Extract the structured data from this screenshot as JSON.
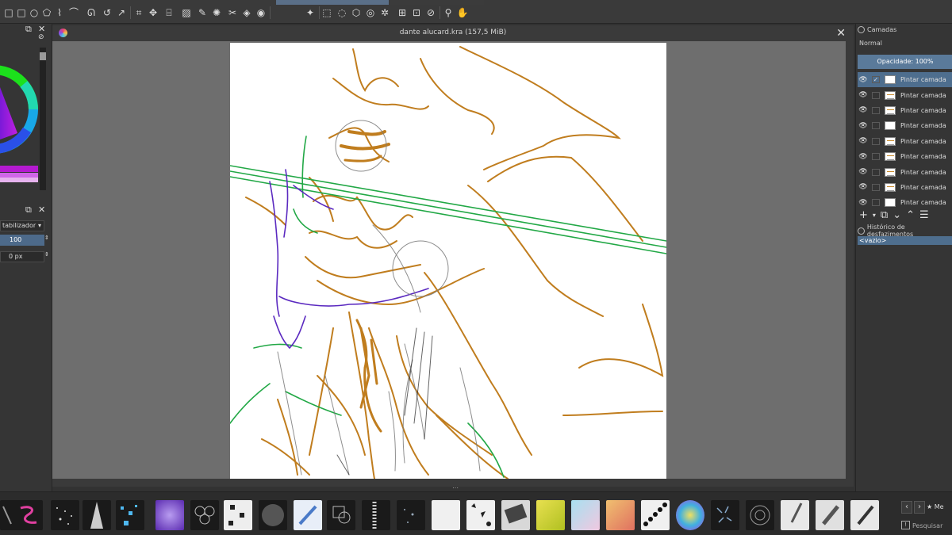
{
  "canvas": {
    "title": "dante alucard.kra (157,5 MiB)"
  },
  "left_dock": {
    "stabilizer_label": "tabilizador",
    "stabilizer_value": "100",
    "offset_value": "0 px"
  },
  "layers_panel": {
    "title": "Camadas",
    "blend_mode": "Normal",
    "opacity_label": "Opacidade:  100%",
    "layers": [
      {
        "name": "Pintar camada",
        "active": true,
        "checked": true
      },
      {
        "name": "Pintar camada",
        "active": false,
        "checked": false
      },
      {
        "name": "Pintar camada",
        "active": false,
        "checked": false
      },
      {
        "name": "Pintar camada",
        "active": false,
        "checked": false
      },
      {
        "name": "Pintar camada",
        "active": false,
        "checked": false
      },
      {
        "name": "Pintar camada",
        "active": false,
        "checked": false
      },
      {
        "name": "Pintar camada",
        "active": false,
        "checked": false
      },
      {
        "name": "Pintar camada",
        "active": false,
        "checked": false
      },
      {
        "name": "Pintar camada",
        "active": false,
        "checked": false
      }
    ]
  },
  "undo_history": {
    "title": "Histórico de desfazimentos",
    "items": [
      "<vazio>"
    ]
  },
  "brush_panel": {
    "tag_button": "★ Me",
    "search_placeholder": "Pesquisar"
  },
  "colors": {
    "accent": "#4e6e8e",
    "sketch_orange": "#c07d1e",
    "sketch_green": "#22a846",
    "sketch_purple": "#5b2ac0"
  }
}
